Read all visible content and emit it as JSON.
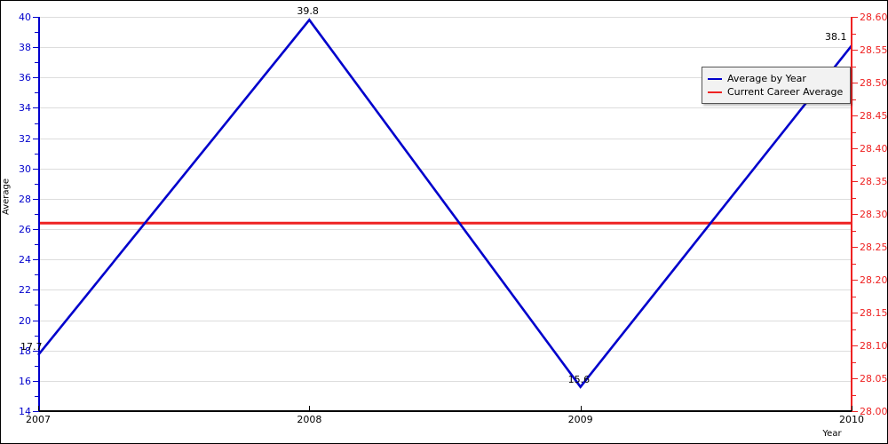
{
  "chart_data": {
    "type": "line",
    "title": "",
    "xlabel": "Year",
    "ylabel": "Average",
    "x": [
      2007,
      2008,
      2009,
      2010
    ],
    "xlim": [
      2007,
      2010
    ],
    "ylim": [
      14,
      40
    ],
    "y_ticks": [
      14,
      16,
      18,
      20,
      22,
      24,
      26,
      28,
      30,
      32,
      34,
      36,
      38,
      40
    ],
    "grid": true,
    "legend_position": "top-right",
    "series": [
      {
        "name": "Average by Year",
        "color": "#0000cc",
        "axis": "left",
        "values": [
          17.7,
          39.8,
          15.6,
          38.1
        ],
        "point_labels": [
          "17.7",
          "39.8",
          "15.6",
          "38.1"
        ]
      },
      {
        "name": "Current Career Average",
        "color": "#ee2222",
        "axis": "left",
        "constant_value": 26.4,
        "right_axis_value": 28.29
      }
    ],
    "secondary_axis": {
      "label": "",
      "color": "#ee2222",
      "ylim": [
        28.0,
        28.6
      ],
      "ticks": [
        "28.00",
        "28.05",
        "28.10",
        "28.15",
        "28.20",
        "28.25",
        "28.30",
        "28.35",
        "28.40",
        "28.45",
        "28.50",
        "28.55",
        "28.60"
      ]
    }
  },
  "axes": {
    "left": {
      "title": "Average",
      "color": "#0000cc",
      "tick_labels": [
        "40",
        "38",
        "36",
        "34",
        "32",
        "30",
        "28",
        "26",
        "24",
        "22",
        "20",
        "18",
        "16",
        "14"
      ]
    },
    "right": {
      "color": "#ee2222",
      "tick_labels": [
        "28.60",
        "28.55",
        "28.50",
        "28.45",
        "28.40",
        "28.35",
        "28.30",
        "28.25",
        "28.20",
        "28.15",
        "28.10",
        "28.05",
        "28.00"
      ]
    },
    "bottom": {
      "title": "Year",
      "color": "#000000",
      "tick_labels": [
        "2007",
        "2008",
        "2009",
        "2010"
      ]
    }
  },
  "legend": {
    "items": [
      {
        "label": "Average by Year",
        "color": "#0000cc"
      },
      {
        "label": "Current Career Average",
        "color": "#ee2222"
      }
    ]
  },
  "data_labels": [
    {
      "text": "17.7",
      "x": 2007,
      "y": 17.7
    },
    {
      "text": "39.8",
      "x": 2008,
      "y": 39.8
    },
    {
      "text": "15.6",
      "x": 2009,
      "y": 15.6
    },
    {
      "text": "38.1",
      "x": 2010,
      "y": 38.1
    }
  ],
  "colors": {
    "series_line": "#0000cc",
    "career_line": "#ee2222",
    "grid": "#dddddd",
    "background": "#ffffff",
    "frame": "#000000",
    "legend_background": "#f2f2f2"
  }
}
